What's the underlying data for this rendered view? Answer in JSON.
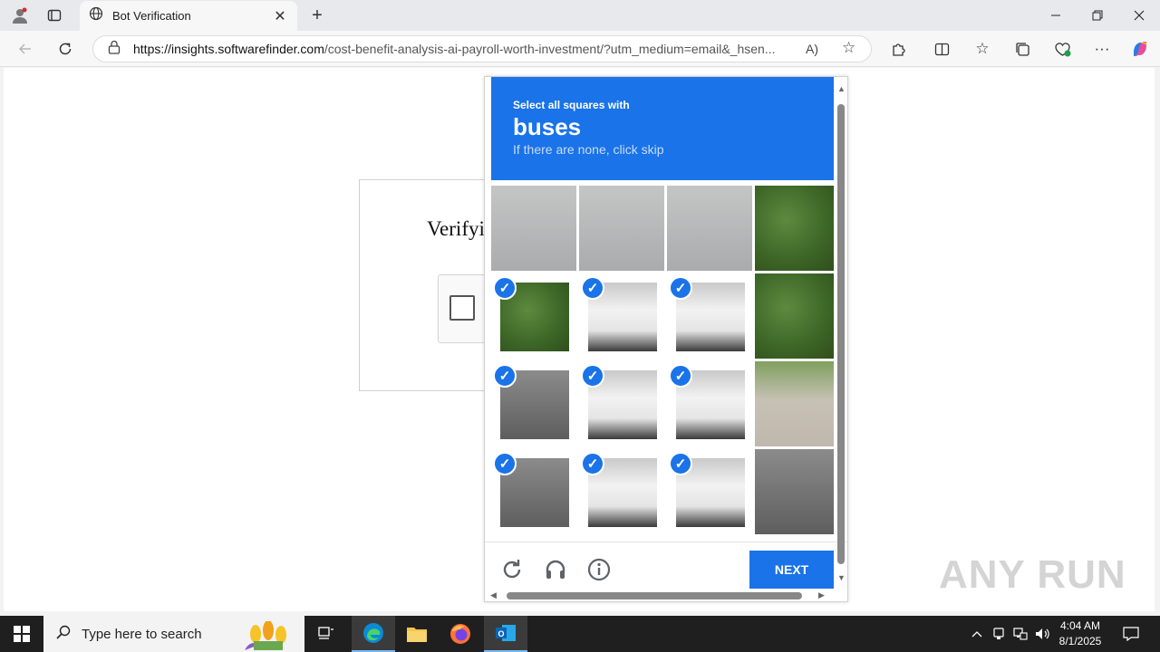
{
  "browser": {
    "tab_title": "Bot Verification",
    "url_host": "https://insights.softwarefinder.com",
    "url_path": "/cost-benefit-analysis-ai-payroll-worth-investment/?utm_medium=email&_hsen..."
  },
  "page": {
    "verify_title": "Verifyi"
  },
  "captcha": {
    "instruction_small": "Select all squares with",
    "target": "buses",
    "hint": "If there are none, click skip",
    "next_label": "NEXT",
    "tiles": [
      {
        "scene": "sky",
        "selected": false
      },
      {
        "scene": "sky",
        "selected": false
      },
      {
        "scene": "sky",
        "selected": false
      },
      {
        "scene": "trees",
        "selected": false
      },
      {
        "scene": "trees",
        "selected": true
      },
      {
        "scene": "bus",
        "selected": true
      },
      {
        "scene": "bus",
        "selected": true
      },
      {
        "scene": "trees",
        "selected": false
      },
      {
        "scene": "road",
        "selected": true
      },
      {
        "scene": "bus",
        "selected": true
      },
      {
        "scene": "bus",
        "selected": true
      },
      {
        "scene": "walk",
        "selected": false
      },
      {
        "scene": "road",
        "selected": true
      },
      {
        "scene": "bus",
        "selected": true
      },
      {
        "scene": "bus",
        "selected": true
      },
      {
        "scene": "road",
        "selected": false
      }
    ],
    "accent_color": "#1a73e8"
  },
  "watermark": "ANY RUN",
  "taskbar": {
    "search_placeholder": "Type here to search",
    "time": "4:04 AM",
    "date": "8/1/2025"
  }
}
